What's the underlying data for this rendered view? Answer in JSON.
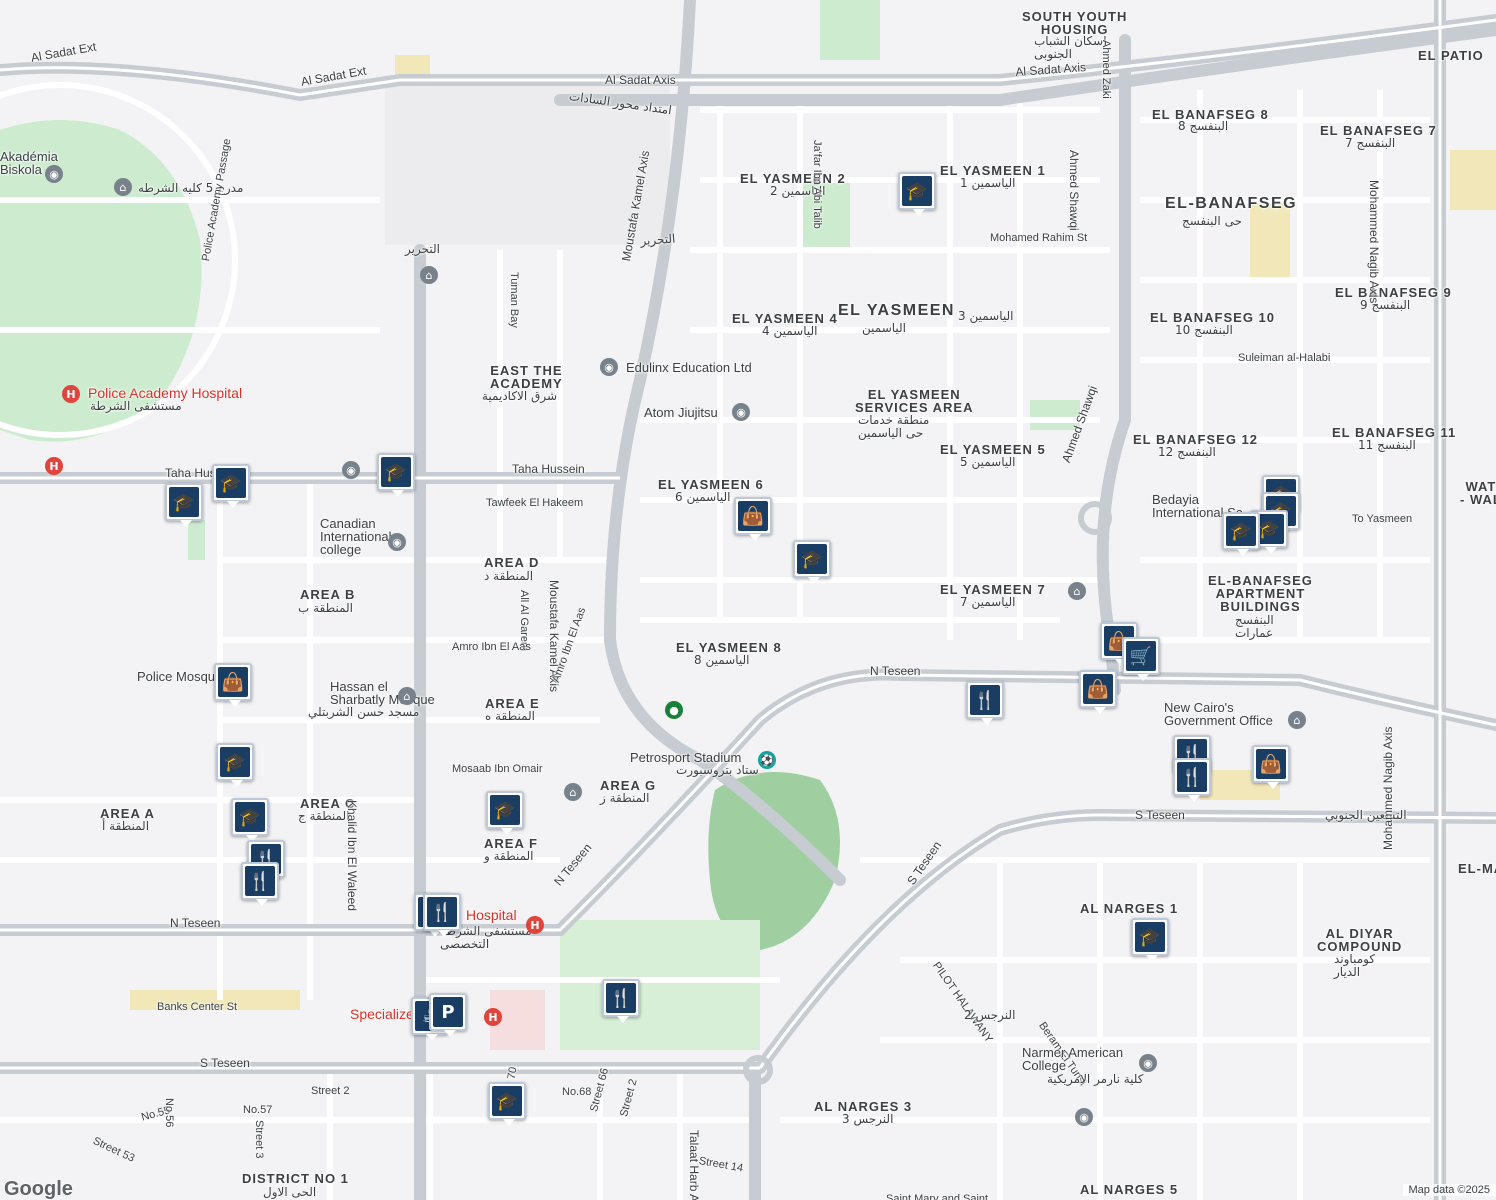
{
  "map": {
    "colors": {
      "background": "#f3f2f4",
      "park": "#cdeccf",
      "road": "#ffffff",
      "major_road": "#c6ccd2",
      "pin": "#1a3d64"
    },
    "attribution": "Map data ©2025",
    "logo": "Google",
    "labels": [
      {
        "id": "south-youth-housing",
        "text": "SOUTH YOUTH\nHOUSING",
        "kind": "area"
      },
      {
        "id": "south-youth-housing-ar",
        "text": "اسكان الشباب\nالجنوبى",
        "kind": "ar"
      },
      {
        "id": "el-patio",
        "text": "EL PATIO",
        "kind": "area"
      },
      {
        "id": "al-sadat-ext-1",
        "text": "Al Sadat Ext",
        "kind": "road"
      },
      {
        "id": "al-sadat-ext-2",
        "text": "Al Sadat Ext",
        "kind": "road"
      },
      {
        "id": "al-sadat-axis-1",
        "text": "Al Sadat Axis",
        "kind": "road"
      },
      {
        "id": "al-sadat-axis-2",
        "text": "Al Sadat Axis",
        "kind": "road"
      },
      {
        "id": "sadat-ar",
        "text": "امتداد محور السادات",
        "kind": "ar"
      },
      {
        "id": "el-banafseg-8",
        "text": "EL BANAFSEG 8",
        "kind": "area"
      },
      {
        "id": "el-banafseg-8-ar",
        "text": "البنفسج 8",
        "kind": "ar"
      },
      {
        "id": "el-banafseg-7",
        "text": "EL BANAFSEG 7",
        "kind": "area"
      },
      {
        "id": "el-banafseg-7-ar",
        "text": "البنفسج 7",
        "kind": "ar"
      },
      {
        "id": "el-yasmeen-2",
        "text": "EL YASMEEN 2",
        "kind": "area"
      },
      {
        "id": "el-yasmeen-2-ar",
        "text": "الياسمين 2",
        "kind": "ar"
      },
      {
        "id": "el-yasmeen-1",
        "text": "EL YASMEEN 1",
        "kind": "area"
      },
      {
        "id": "el-yasmeen-1-ar",
        "text": "الياسمين 1",
        "kind": "ar"
      },
      {
        "id": "el-banafseg",
        "text": "EL-BANAFSEG",
        "kind": "big"
      },
      {
        "id": "el-banafseg-ar",
        "text": "حى البنفسج",
        "kind": "ar"
      },
      {
        "id": "academia",
        "text": "Akadémia\nBiskola",
        "kind": "blue"
      },
      {
        "id": "police-college",
        "text": "مدرج 5 كليه الشرطه",
        "kind": "ar"
      },
      {
        "id": "mohamed-rahim",
        "text": "Mohamed Rahim St",
        "kind": "small"
      },
      {
        "id": "el-tahrir-1",
        "text": "التحرير",
        "kind": "ar"
      },
      {
        "id": "el-tahrir-2",
        "text": "التحرير",
        "kind": "ar"
      },
      {
        "id": "moustafa-kamel-1",
        "text": "Moustafa Kamel Axis",
        "kind": "road"
      },
      {
        "id": "moustafa-kamel-2",
        "text": "Moustafa Kamel Axis",
        "kind": "road"
      },
      {
        "id": "police-academy-passage",
        "text": "Police Academy Passage",
        "kind": "small"
      },
      {
        "id": "tuman-bay",
        "text": "Tuman Bay",
        "kind": "small"
      },
      {
        "id": "el-yasmeen-4",
        "text": "EL YASMEEN 4",
        "kind": "area"
      },
      {
        "id": "el-yasmeen-4-ar",
        "text": "الياسمين 4",
        "kind": "ar"
      },
      {
        "id": "el-yasmeen",
        "text": "EL YASMEEN",
        "kind": "big"
      },
      {
        "id": "el-yasmeen-ar",
        "text": "الياسمين",
        "kind": "ar"
      },
      {
        "id": "el-yasmeen-3-ar",
        "text": "الياسمين 3",
        "kind": "ar"
      },
      {
        "id": "el-banafseg-9",
        "text": "EL BANAFSEG 9",
        "kind": "area"
      },
      {
        "id": "el-banafseg-9-ar",
        "text": "البنفسج 9",
        "kind": "ar"
      },
      {
        "id": "el-banafseg-10",
        "text": "EL BANAFSEG 10",
        "kind": "area"
      },
      {
        "id": "el-banafseg-10-ar",
        "text": "البنفسج 10",
        "kind": "ar"
      },
      {
        "id": "suleiman",
        "text": "Suleiman al-Halabi",
        "kind": "small"
      },
      {
        "id": "east-academy",
        "text": "EAST THE\nACADEMY",
        "kind": "area"
      },
      {
        "id": "east-academy-ar",
        "text": "شرق الاكاديمية",
        "kind": "ar"
      },
      {
        "id": "edulinx",
        "text": "Edulinx Education Ltd",
        "kind": "blue"
      },
      {
        "id": "police-hospital",
        "text": "Police Academy Hospital",
        "kind": "red"
      },
      {
        "id": "police-hospital-ar",
        "text": "مستشفى الشرطة",
        "kind": "ar"
      },
      {
        "id": "atom",
        "text": "Atom Jiujitsu",
        "kind": "blue"
      },
      {
        "id": "services-area",
        "text": "EL YASMEEN\nSERVICES AREA",
        "kind": "area"
      },
      {
        "id": "services-area-ar",
        "text": "منطقة خدمات\nحى الياسمين",
        "kind": "ar"
      },
      {
        "id": "el-banafseg-12",
        "text": "EL BANAFSEG 12",
        "kind": "area"
      },
      {
        "id": "el-banafseg-12-ar",
        "text": "البنفسج 12",
        "kind": "ar"
      },
      {
        "id": "el-banafseg-11",
        "text": "EL BANAFSEG 11",
        "kind": "area"
      },
      {
        "id": "el-banafseg-11-ar",
        "text": "البنفسج 11",
        "kind": "ar"
      },
      {
        "id": "el-yasmeen-5",
        "text": "EL YASMEEN 5",
        "kind": "area"
      },
      {
        "id": "el-yasmeen-5-ar",
        "text": "الياسمين 5",
        "kind": "ar"
      },
      {
        "id": "taha-hussein-1",
        "text": "Taha Hussein",
        "kind": "road"
      },
      {
        "id": "taha-hussein-2",
        "text": "Taha Hussein",
        "kind": "road"
      },
      {
        "id": "el-yasmeen-6",
        "text": "EL YASMEEN 6",
        "kind": "area"
      },
      {
        "id": "el-yasmeen-6-ar",
        "text": "الياسمين 6",
        "kind": "ar"
      },
      {
        "id": "tawfeek",
        "text": "Tawfeek El Hakeem",
        "kind": "small"
      },
      {
        "id": "ahmed-shawqi-1",
        "text": "Ahmed Shawqi",
        "kind": "road"
      },
      {
        "id": "ahmed-shawqi-2",
        "text": "Ahmed Shawqi",
        "kind": "road"
      },
      {
        "id": "bedayia",
        "text": "Bedayia\nInternational Sc",
        "kind": "blue"
      },
      {
        "id": "to-yasmeen",
        "text": "To Yasmeen",
        "kind": "small"
      },
      {
        "id": "canadian",
        "text": "Canadian\nInternational\ncollege",
        "kind": "blue"
      },
      {
        "id": "area-d",
        "text": "AREA D",
        "kind": "area"
      },
      {
        "id": "area-d-ar",
        "text": "المنطقة د",
        "kind": "ar"
      },
      {
        "id": "area-b",
        "text": "AREA B",
        "kind": "area"
      },
      {
        "id": "area-b-ar",
        "text": "المنطقة ب",
        "kind": "ar"
      },
      {
        "id": "all-al-garem",
        "text": "All Al Garem",
        "kind": "small"
      },
      {
        "id": "el-yasmeen-7",
        "text": "EL YASMEEN 7",
        "kind": "area"
      },
      {
        "id": "el-yasmeen-7-ar",
        "text": "الياسمين 7",
        "kind": "ar"
      },
      {
        "id": "banafseg-apartment",
        "text": "EL-BANAFSEG\nAPARTMENT\nBUILDINGS",
        "kind": "area"
      },
      {
        "id": "banafseg-apartment-ar",
        "text": "البنفسج\nعمارات",
        "kind": "ar"
      },
      {
        "id": "amro-ibn-el-aas",
        "text": "Amro Ibn El Aas",
        "kind": "small"
      },
      {
        "id": "el-yasmeen-8",
        "text": "EL YASMEEN 8",
        "kind": "area"
      },
      {
        "id": "el-yasmeen-8-ar",
        "text": "الياسمين 8",
        "kind": "ar"
      },
      {
        "id": "n-teseen-1",
        "text": "N Teseen",
        "kind": "road"
      },
      {
        "id": "n-teseen-2",
        "text": "N Teseen",
        "kind": "road"
      },
      {
        "id": "n-teseen-3",
        "text": "N Teseen",
        "kind": "road"
      },
      {
        "id": "police-mosque",
        "text": "Police Mosque",
        "kind": "blue"
      },
      {
        "id": "hassan-sharbatly",
        "text": "Hassan el\nSharbatly Mosque",
        "kind": "blue"
      },
      {
        "id": "hassan-sharbatly-ar",
        "text": "مسجد حسن الشربتلي",
        "kind": "ar"
      },
      {
        "id": "area-e",
        "text": "AREA E",
        "kind": "area"
      },
      {
        "id": "area-e-ar",
        "text": "المنطقة ه",
        "kind": "ar"
      },
      {
        "id": "amro-ibn-el-aas-2",
        "text": "Amro Ibn El Aas",
        "kind": "small"
      },
      {
        "id": "new-cairo-gov",
        "text": "New Cairo's\nGovernment Office",
        "kind": "blue"
      },
      {
        "id": "petrosport",
        "text": "Petrosport Stadium",
        "kind": "blue"
      },
      {
        "id": "petrosport-ar",
        "text": "ستاد بتروسبورت",
        "kind": "ar"
      },
      {
        "id": "mosaab",
        "text": "Mosaab Ibn Omair",
        "kind": "small"
      },
      {
        "id": "area-g",
        "text": "AREA G",
        "kind": "area"
      },
      {
        "id": "area-g-ar",
        "text": "المنطقة ز",
        "kind": "ar"
      },
      {
        "id": "area-a",
        "text": "AREA A",
        "kind": "area"
      },
      {
        "id": "area-a-ar",
        "text": "المنطقة أ",
        "kind": "ar"
      },
      {
        "id": "area-c",
        "text": "AREA C",
        "kind": "area"
      },
      {
        "id": "area-c-ar",
        "text": "المنطقة ج",
        "kind": "ar"
      },
      {
        "id": "s-teseen-1",
        "text": "S Teseen",
        "kind": "road"
      },
      {
        "id": "s-teseen-ar",
        "text": "التسعين الجنوبي",
        "kind": "ar"
      },
      {
        "id": "area-f",
        "text": "AREA F",
        "kind": "area"
      },
      {
        "id": "area-f-ar",
        "text": "المنطقة و",
        "kind": "ar"
      },
      {
        "id": "khalid-ibn-el-waleed",
        "text": "Khalid Ibn El Waleed",
        "kind": "road"
      },
      {
        "id": "s-teseen-2",
        "text": "S Teseen",
        "kind": "road"
      },
      {
        "id": "s-teseen-3",
        "text": "S Teseen",
        "kind": "road"
      },
      {
        "id": "al-nerges-1",
        "text": "AL NARGES 1",
        "kind": "area"
      },
      {
        "id": "al-diyar",
        "text": "AL DIYAR\nCOMPOUND",
        "kind": "area"
      },
      {
        "id": "al-diyar-ar",
        "text": "كومباوند\nالديار",
        "kind": "ar"
      },
      {
        "id": "hospital-1",
        "text": "Hospital",
        "kind": "red"
      },
      {
        "id": "hospital-1-ar",
        "text": "مستشفى الشرطة\nالتخصصى",
        "kind": "ar"
      },
      {
        "id": "pilot-halawany",
        "text": "PILOT HALAWANY",
        "kind": "small"
      },
      {
        "id": "banks-center",
        "text": "Banks Center St",
        "kind": "small"
      },
      {
        "id": "specialized",
        "text": "Specialize",
        "kind": "red"
      },
      {
        "id": "al-nerges-2-ar",
        "text": "النرجس 2",
        "kind": "ar"
      },
      {
        "id": "beram",
        "text": "Beram El Tunsi",
        "kind": "small"
      },
      {
        "id": "narmer",
        "text": "Narmer American\nCollege",
        "kind": "blue"
      },
      {
        "id": "narmer-ar",
        "text": "كلية نارمر الامريكية",
        "kind": "ar"
      },
      {
        "id": "mohammed-naguib-1",
        "text": "Mohammed Nagib Axis",
        "kind": "road"
      },
      {
        "id": "mohammed-naguib-2",
        "text": "Mohammed Nagib Axis",
        "kind": "road"
      },
      {
        "id": "al-narges-3",
        "text": "AL NARGES 3",
        "kind": "area"
      },
      {
        "id": "al-narges-3-ar",
        "text": "النرجس 3",
        "kind": "ar"
      },
      {
        "id": "al-narges-5",
        "text": "AL NARGES 5",
        "kind": "area"
      },
      {
        "id": "district-1",
        "text": "DISTRICT NO 1",
        "kind": "area"
      },
      {
        "id": "district-1-ar",
        "text": "الحى الاول",
        "kind": "ar"
      },
      {
        "id": "talaat-harb",
        "text": "Talaat Harb Axis",
        "kind": "road"
      },
      {
        "id": "street-2",
        "text": "Street 2",
        "kind": "small"
      },
      {
        "id": "no-68",
        "text": "No.68",
        "kind": "small"
      },
      {
        "id": "street-70",
        "text": "Street 70",
        "kind": "small"
      },
      {
        "id": "street-66",
        "text": "Street 66",
        "kind": "small"
      },
      {
        "id": "street-2b",
        "text": "Street 2",
        "kind": "small"
      },
      {
        "id": "street-14",
        "text": "Street 14",
        "kind": "small"
      },
      {
        "id": "no-55",
        "text": "No.55",
        "kind": "small"
      },
      {
        "id": "no-56",
        "text": "No.56",
        "kind": "small"
      },
      {
        "id": "no-57",
        "text": "No.57",
        "kind": "small"
      },
      {
        "id": "street-53",
        "text": "Street 53",
        "kind": "small"
      },
      {
        "id": "street-3",
        "text": "Street 3",
        "kind": "small"
      },
      {
        "id": "saint-mary",
        "text": "Saint Mary and Saint",
        "kind": "small"
      },
      {
        "id": "el-mah",
        "text": "EL-MA",
        "kind": "area"
      },
      {
        "id": "jafar",
        "text": "Ja'far Ibn Abi Talib",
        "kind": "small"
      },
      {
        "id": "ahmed-zewail",
        "text": "Ahmed Zaki",
        "kind": "small"
      },
      {
        "id": "wat",
        "text": "WAT\n- WAL",
        "kind": "area"
      }
    ],
    "pins": [
      {
        "id": "school-yasmeen-1",
        "icon": "school"
      },
      {
        "id": "school-taha-1",
        "icon": "school"
      },
      {
        "id": "school-taha-2",
        "icon": "school"
      },
      {
        "id": "school-taha-3",
        "icon": "school"
      },
      {
        "id": "shop-yasmeen-6",
        "icon": "shopping"
      },
      {
        "id": "school-yasmeen-6",
        "icon": "school"
      },
      {
        "id": "school-bedayia-1",
        "icon": "school"
      },
      {
        "id": "school-bedayia-2",
        "icon": "school"
      },
      {
        "id": "school-bedayia-3",
        "icon": "school"
      },
      {
        "id": "school-bedayia-4",
        "icon": "school"
      },
      {
        "id": "shop-police-mosque",
        "icon": "shopping"
      },
      {
        "id": "shop-banafseg-1",
        "icon": "shopping"
      },
      {
        "id": "cart-banafseg",
        "icon": "cart"
      },
      {
        "id": "restaurant-n-teseen",
        "icon": "restaurant"
      },
      {
        "id": "shop-n-teseen",
        "icon": "shopping"
      },
      {
        "id": "school-area-a",
        "icon": "school"
      },
      {
        "id": "school-area-c",
        "icon": "school"
      },
      {
        "id": "restaurant-area-c-1",
        "icon": "restaurant"
      },
      {
        "id": "restaurant-area-c-2",
        "icon": "restaurant"
      },
      {
        "id": "restaurant-gov-1",
        "icon": "restaurant"
      },
      {
        "id": "restaurant-gov-2",
        "icon": "restaurant"
      },
      {
        "id": "shop-gov",
        "icon": "shopping"
      },
      {
        "id": "school-area-f",
        "icon": "school"
      },
      {
        "id": "restaurant-n-teseen-2",
        "icon": "restaurant"
      },
      {
        "id": "restaurant-hospital",
        "icon": "restaurant"
      },
      {
        "id": "school-narges-1",
        "icon": "school"
      },
      {
        "id": "restaurant-park",
        "icon": "restaurant"
      },
      {
        "id": "cafe-specialized",
        "icon": "cafe"
      },
      {
        "id": "parking-specialized",
        "icon": "parking"
      },
      {
        "id": "school-street-70",
        "icon": "school"
      }
    ]
  }
}
